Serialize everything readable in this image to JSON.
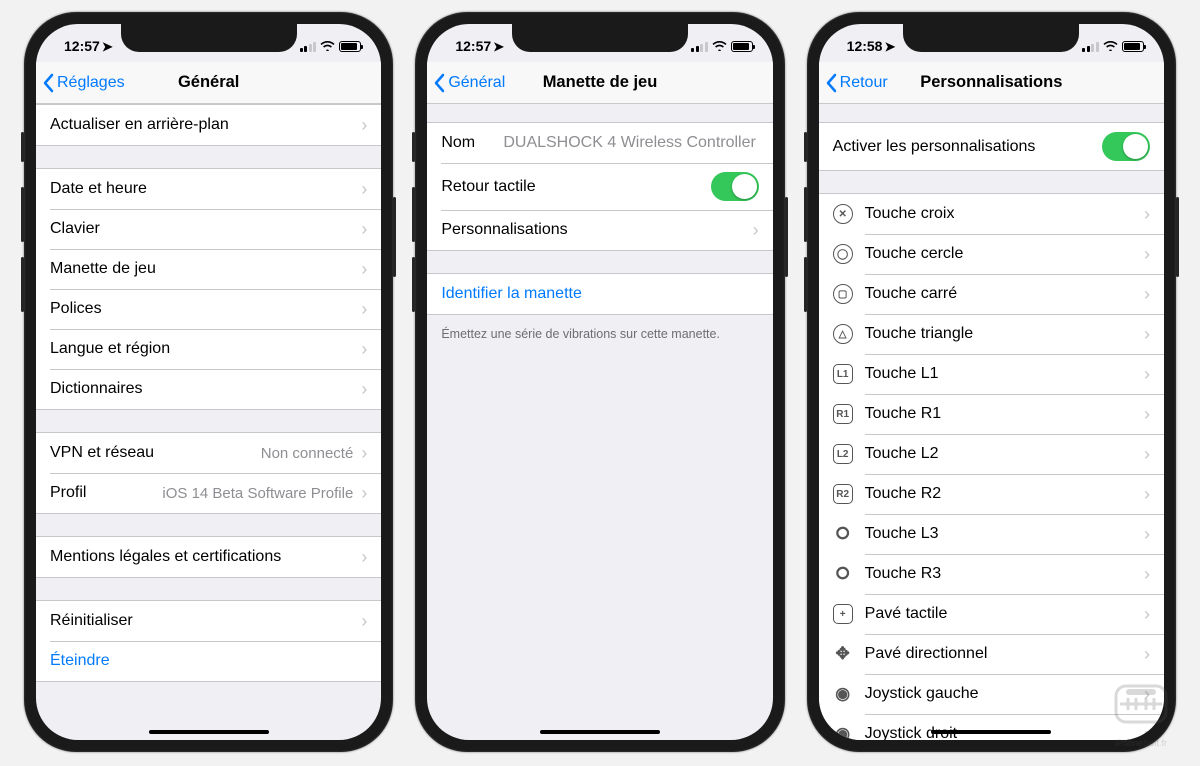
{
  "watermark": "iPhoneSoft.fr",
  "phone1": {
    "status": {
      "time": "12:57"
    },
    "nav": {
      "back": "Réglages",
      "title": "Général"
    },
    "g1": [
      {
        "label": "Actualiser en arrière-plan"
      }
    ],
    "g2": [
      {
        "label": "Date et heure"
      },
      {
        "label": "Clavier"
      },
      {
        "label": "Manette de jeu"
      },
      {
        "label": "Polices"
      },
      {
        "label": "Langue et région"
      },
      {
        "label": "Dictionnaires"
      }
    ],
    "g3": [
      {
        "label": "VPN et réseau",
        "detail": "Non connecté"
      },
      {
        "label": "Profil",
        "detail": "iOS 14 Beta Software Profile"
      }
    ],
    "g4": [
      {
        "label": "Mentions légales et certifications"
      }
    ],
    "g5": [
      {
        "label": "Réinitialiser"
      },
      {
        "label": "Éteindre",
        "link": true
      }
    ]
  },
  "phone2": {
    "status": {
      "time": "12:57"
    },
    "nav": {
      "back": "Général",
      "title": "Manette de jeu"
    },
    "r_nom_key": "Nom",
    "r_nom_val": "DUALSHOCK 4 Wireless Controller",
    "r_haptic": "Retour tactile",
    "r_custom": "Personnalisations",
    "r_identify": "Identifier la manette",
    "footer": "Émettez une série de vibrations sur cette manette."
  },
  "phone3": {
    "status": {
      "time": "12:58"
    },
    "nav": {
      "back": "Retour",
      "title": "Personnalisations"
    },
    "r_activate": "Activer les personnalisations",
    "buttons": [
      {
        "icon": "cross",
        "label": "Touche croix"
      },
      {
        "icon": "circle",
        "label": "Touche cercle"
      },
      {
        "icon": "square",
        "label": "Touche carré"
      },
      {
        "icon": "triangle",
        "label": "Touche triangle"
      },
      {
        "icon": "L1",
        "label": "Touche L1"
      },
      {
        "icon": "R1",
        "label": "Touche R1"
      },
      {
        "icon": "L2",
        "label": "Touche L2"
      },
      {
        "icon": "R2",
        "label": "Touche R2"
      },
      {
        "icon": "L3",
        "label": "Touche L3"
      },
      {
        "icon": "R3",
        "label": "Touche R3"
      },
      {
        "icon": "touchpad",
        "label": "Pavé tactile"
      },
      {
        "icon": "dpad",
        "label": "Pavé directionnel"
      },
      {
        "icon": "stickL",
        "label": "Joystick gauche"
      },
      {
        "icon": "stickR",
        "label": "Joystick droit"
      }
    ]
  }
}
